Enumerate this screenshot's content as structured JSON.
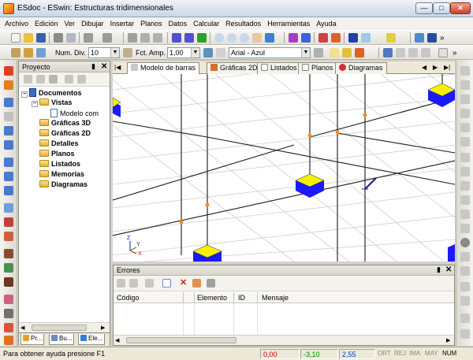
{
  "window": {
    "title": "ESdoc - ESwin: Estructuras tridimensionales",
    "minimize": "—",
    "maximize": "□",
    "close": "✕"
  },
  "menu": [
    "Archivo",
    "Edición",
    "Ver",
    "Dibujar",
    "Insertar",
    "Planos",
    "Datos",
    "Calcular",
    "Resultados",
    "Herramientas",
    "Ayuda"
  ],
  "toolbar2": {
    "num_div_label": "Num. Div.",
    "num_div_value": "10",
    "fct_amp_label": "Fct. Amp.",
    "fct_amp_value": "1,00",
    "font_value": "Arial - Azul"
  },
  "project": {
    "title": "Proyecto",
    "pin": "▮",
    "close": "✕",
    "tree": {
      "root": "Documentos",
      "vistas": "Vistas",
      "modelo": "Modelo com",
      "graficas3d": "Gráficas 3D",
      "graficas2d": "Gráficas 2D",
      "detalles": "Detalles",
      "planos": "Planos",
      "listados": "Listados",
      "memorias": "Memorias",
      "diagramas": "Diagramas"
    },
    "tabs": [
      "Pr...",
      "Bu...",
      "Ele..."
    ]
  },
  "doc_tabs": {
    "modelo": "Modelo de barras",
    "graficas2d": "Gráficas 2D",
    "listados": "Listados",
    "planos": "Planos",
    "diagramas": "Diagramas"
  },
  "canvas": {
    "axis_x": "X",
    "axis_y": "Y",
    "axis_z": "Z"
  },
  "errors": {
    "title": "Errores",
    "columns": [
      "Código",
      "Elemento",
      "ID",
      "Mensaje"
    ]
  },
  "status": {
    "help": "Para obtener ayuda presione F1",
    "coord1": "0,00",
    "coord2": "-3,10",
    "coord3": "2,55",
    "flags": [
      "ORT",
      "REJ",
      "IMA",
      "MAY",
      "NUM"
    ]
  },
  "colors": {
    "node": "#ff8c1a",
    "support_top": "#f5f000",
    "support_base": "#1a1aff",
    "coord1": "#d40000",
    "coord2": "#008a00",
    "coord3": "#0040c0"
  }
}
